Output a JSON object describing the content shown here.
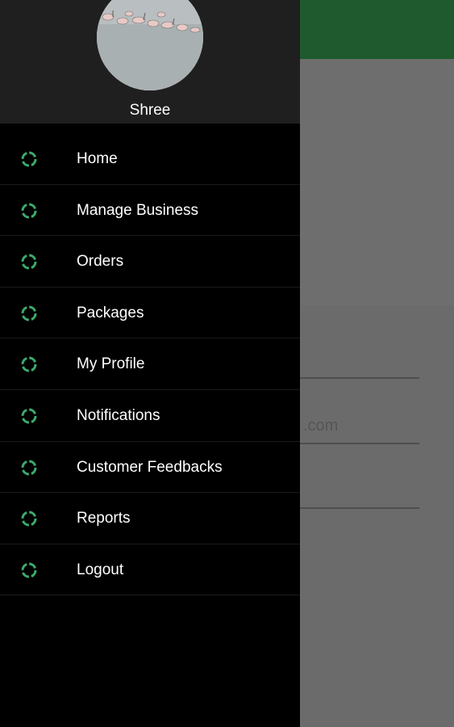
{
  "user": {
    "name": "Shree"
  },
  "background_form": {
    "email_fragment": ".com"
  },
  "menu": {
    "items": [
      {
        "label": "Home",
        "icon": "loader-ring-icon"
      },
      {
        "label": "Manage Business",
        "icon": "loader-ring-icon"
      },
      {
        "label": "Orders",
        "icon": "loader-ring-icon"
      },
      {
        "label": "Packages",
        "icon": "loader-ring-icon"
      },
      {
        "label": "My Profile",
        "icon": "loader-ring-icon"
      },
      {
        "label": "Notifications",
        "icon": "loader-ring-icon"
      },
      {
        "label": "Customer Feedbacks",
        "icon": "loader-ring-icon"
      },
      {
        "label": "Reports",
        "icon": "loader-ring-icon"
      },
      {
        "label": "Logout",
        "icon": "loader-ring-icon"
      }
    ]
  },
  "colors": {
    "app_bar": "#1f5a2e",
    "drawer": "#000000",
    "drawer_header": "#1f1f1f",
    "icon_accent": "#3daa6e",
    "scrim": "#6a6a6a"
  }
}
